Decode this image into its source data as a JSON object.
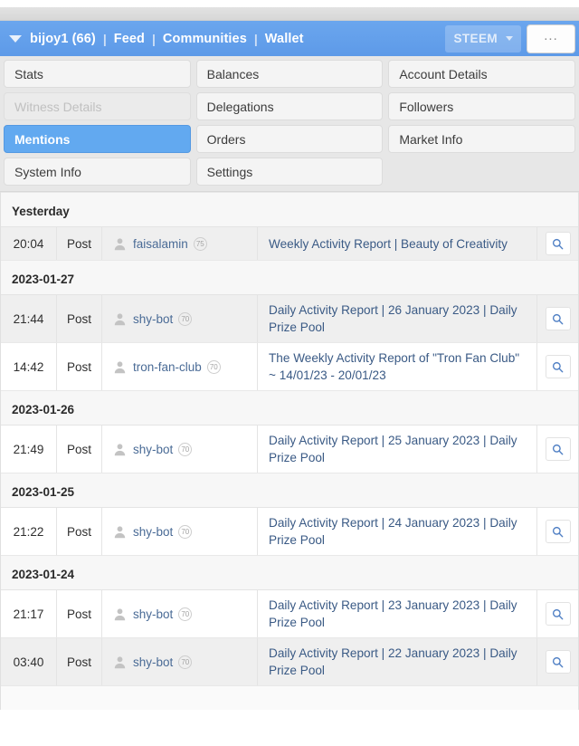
{
  "navbar": {
    "account_caret_icon": "caret-down-icon",
    "account": "bijoy1 (66)",
    "separator": "|",
    "links": [
      "Feed",
      "Communities",
      "Wallet"
    ],
    "chain_selected": "STEEM",
    "chain_caret_icon": "caret-down-small-icon",
    "more_label": "...",
    "accent_color": "#62a9f0"
  },
  "tabs": [
    {
      "label": "Stats",
      "state": "normal"
    },
    {
      "label": "Balances",
      "state": "normal"
    },
    {
      "label": "Account Details",
      "state": "normal"
    },
    {
      "label": "Witness Details",
      "state": "disabled"
    },
    {
      "label": "Delegations",
      "state": "normal"
    },
    {
      "label": "Followers",
      "state": "normal"
    },
    {
      "label": "Mentions",
      "state": "active"
    },
    {
      "label": "Orders",
      "state": "normal"
    },
    {
      "label": "Market Info",
      "state": "normal"
    },
    {
      "label": "System Info",
      "state": "normal"
    },
    {
      "label": "Settings",
      "state": "normal"
    },
    {
      "label": "",
      "state": "empty"
    }
  ],
  "mentions": {
    "groups": [
      {
        "date_label": "Yesterday",
        "rows": [
          {
            "time": "20:04",
            "type": "Post",
            "author": "faisalamin",
            "reputation": "75",
            "title": "Weekly Activity Report | Beauty of Creativity",
            "avatar_icon": "user-avatar-icon",
            "action_icon": "search-icon"
          }
        ]
      },
      {
        "date_label": "2023-01-27",
        "rows": [
          {
            "time": "21:44",
            "type": "Post",
            "author": "shy-bot",
            "reputation": "70",
            "title": "Daily Activity Report | 26 January 2023 | Daily Prize Pool",
            "avatar_icon": "user-avatar-icon",
            "action_icon": "search-icon"
          },
          {
            "time": "14:42",
            "type": "Post",
            "author": "tron-fan-club",
            "reputation": "70",
            "title": "The Weekly Activity Report of \"Tron Fan Club\" ~ 14/01/23 - 20/01/23",
            "avatar_icon": "user-avatar-icon",
            "action_icon": "search-icon"
          }
        ]
      },
      {
        "date_label": "2023-01-26",
        "rows": [
          {
            "time": "21:49",
            "type": "Post",
            "author": "shy-bot",
            "reputation": "70",
            "title": "Daily Activity Report | 25 January 2023 | Daily Prize Pool",
            "avatar_icon": "user-avatar-icon",
            "action_icon": "search-icon"
          }
        ]
      },
      {
        "date_label": "2023-01-25",
        "rows": [
          {
            "time": "21:22",
            "type": "Post",
            "author": "shy-bot",
            "reputation": "70",
            "title": "Daily Activity Report | 24 January 2023 | Daily Prize Pool",
            "avatar_icon": "user-avatar-icon",
            "action_icon": "search-icon"
          }
        ]
      },
      {
        "date_label": "2023-01-24",
        "rows": [
          {
            "time": "21:17",
            "type": "Post",
            "author": "shy-bot",
            "reputation": "70",
            "title": "Daily Activity Report | 23 January 2023 | Daily Prize Pool",
            "avatar_icon": "user-avatar-icon",
            "action_icon": "search-icon"
          },
          {
            "time": "03:40",
            "type": "Post",
            "author": "shy-bot",
            "reputation": "70",
            "title": "Daily Activity Report | 22 January 2023 | Daily Prize Pool",
            "avatar_icon": "user-avatar-icon",
            "action_icon": "search-icon"
          }
        ]
      }
    ]
  }
}
